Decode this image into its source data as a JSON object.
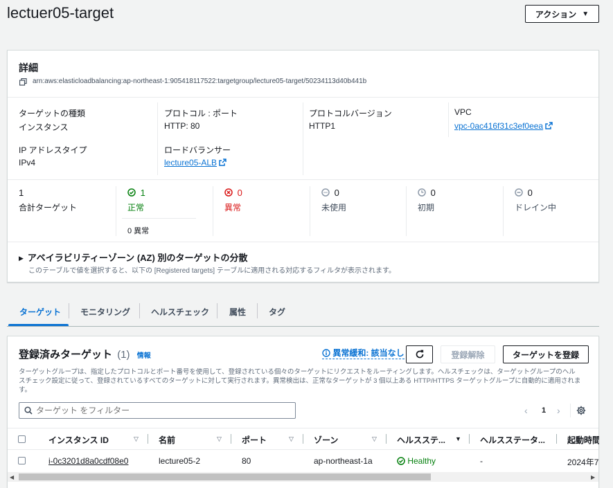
{
  "page": {
    "title": "lectuer05-target",
    "actions_label": "アクション"
  },
  "details": {
    "heading": "詳細",
    "arn": "arn:aws:elasticloadbalancing:ap-northeast-1:905418117522:targetgroup/lecture05-target/50234113d40b441b",
    "target_type_label": "ターゲットの種類",
    "target_type_value": "インスタンス",
    "protocol_label": "プロトコル : ポート",
    "protocol_value": "HTTP: 80",
    "protocol_version_label": "プロトコルバージョン",
    "protocol_version_value": "HTTP1",
    "vpc_label": "VPC",
    "vpc_value": "vpc-0ac416f31c3ef0eea",
    "ip_type_label": "IP アドレスタイプ",
    "ip_type_value": "IPv4",
    "lb_label": "ロードバランサー",
    "lb_value": "lecture05-ALB"
  },
  "counts": {
    "total_value": "1",
    "total_label": "合計ターゲット",
    "healthy_value": "1",
    "healthy_label": "正常",
    "anomaly_text": "0 異常",
    "unhealthy_value": "0",
    "unhealthy_label": "異常",
    "unused_value": "0",
    "unused_label": "未使用",
    "initial_value": "0",
    "initial_label": "初期",
    "draining_value": "0",
    "draining_label": "ドレイン中"
  },
  "az": {
    "title": "アベイラビリティーゾーン (AZ) 別のターゲットの分散",
    "desc": "このテーブルで値を選択すると、以下の [Registered targets] テーブルに適用される対応するフィルタが表示されます。"
  },
  "tabs": [
    "ターゲット",
    "モニタリング",
    "ヘルスチェック",
    "属性",
    "タグ"
  ],
  "registered": {
    "title": "登録済みターゲット",
    "count": "(1)",
    "info": "情報",
    "mitigation": "異常緩和: 該当なし",
    "deregister": "登録解除",
    "register": "ターゲットを登録",
    "desc_line1": "ターゲットグループは、指定したプロトコルとポート番号を使用して、登録されている個々のターゲットにリクエストをルーティングします。ヘルスチェックは、ターゲットグループのヘル",
    "desc_line2": "スチェック設定に従って、登録されているすべてのターゲットに対して実行されます。異常検出は、正常なターゲットが 3 個以上ある HTTP/HTTPS ターゲットグループに自動的に適用されま",
    "desc_line3": "す。",
    "filter_placeholder": "ターゲット をフィルター",
    "page_number": "1"
  },
  "table": {
    "columns": [
      "インスタンス ID",
      "名前",
      "ポート",
      "ゾーン",
      "ヘルスステ...",
      "ヘルスステータ...",
      "起動時間"
    ],
    "rows": [
      {
        "instance_id": "i-0c3201d8a0cdf08e0",
        "name": "lecture05-2",
        "port": "80",
        "zone": "ap-northeast-1a",
        "health": "Healthy",
        "health_detail": "-",
        "launch": "2024年7"
      }
    ]
  },
  "colors": {
    "link": "#0972d3",
    "success": "#037f0c",
    "error": "#d91515",
    "neutral": "#8d99a8"
  }
}
